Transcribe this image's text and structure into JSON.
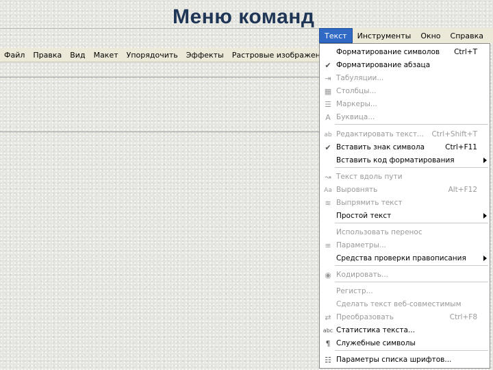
{
  "slide": {
    "title": "Меню команд"
  },
  "main_menubar": [
    "Файл",
    "Правка",
    "Вид",
    "Макет",
    "Упорядочить",
    "Эффекты",
    "Растровые изображения"
  ],
  "top_menubar": [
    {
      "label": "Текст",
      "active": true
    },
    {
      "label": "Инструменты",
      "active": false
    },
    {
      "label": "Окно",
      "active": false
    },
    {
      "label": "Справка",
      "active": false
    }
  ],
  "menu": {
    "items": [
      {
        "label": "Форматирование символов",
        "shortcut": "Ctrl+T",
        "enabled": true,
        "icon": "",
        "submenu": false
      },
      {
        "label": "Форматирование абзаца",
        "shortcut": "",
        "enabled": true,
        "icon": "check-icon",
        "submenu": false
      },
      {
        "label": "Табуляции...",
        "shortcut": "",
        "enabled": false,
        "icon": "tab-icon",
        "submenu": false
      },
      {
        "label": "Столбцы...",
        "shortcut": "",
        "enabled": false,
        "icon": "columns-icon",
        "submenu": false
      },
      {
        "label": "Маркеры...",
        "shortcut": "",
        "enabled": false,
        "icon": "bullets-icon",
        "submenu": false
      },
      {
        "label": "Буквица...",
        "shortcut": "",
        "enabled": false,
        "icon": "dropcap-icon",
        "submenu": false
      },
      {
        "label": "Редактировать текст...",
        "shortcut": "Ctrl+Shift+T",
        "enabled": false,
        "icon": "edit-text-icon",
        "submenu": false
      },
      {
        "label": "Вставить знак символа",
        "shortcut": "Ctrl+F11",
        "enabled": true,
        "icon": "check-icon",
        "submenu": false
      },
      {
        "label": "Вставить код форматирования",
        "shortcut": "",
        "enabled": true,
        "icon": "",
        "submenu": true
      },
      {
        "label": "Текст вдоль пути",
        "shortcut": "",
        "enabled": false,
        "icon": "text-path-icon",
        "submenu": false
      },
      {
        "label": "Выровнять",
        "shortcut": "Alt+F12",
        "enabled": false,
        "icon": "align-icon",
        "submenu": false
      },
      {
        "label": "Выпрямить текст",
        "shortcut": "",
        "enabled": false,
        "icon": "straighten-icon",
        "submenu": false
      },
      {
        "label": "Простой текст",
        "shortcut": "",
        "enabled": true,
        "icon": "",
        "submenu": true
      },
      {
        "label": "Использовать перенос",
        "shortcut": "",
        "enabled": false,
        "icon": "",
        "submenu": false
      },
      {
        "label": "Параметры...",
        "shortcut": "",
        "enabled": false,
        "icon": "params-icon",
        "submenu": false
      },
      {
        "label": "Средства проверки правописания",
        "shortcut": "",
        "enabled": true,
        "icon": "",
        "submenu": true
      },
      {
        "label": "Кодировать...",
        "shortcut": "",
        "enabled": false,
        "icon": "encode-icon",
        "submenu": false
      },
      {
        "label": "Регистр...",
        "shortcut": "",
        "enabled": false,
        "icon": "",
        "submenu": false
      },
      {
        "label": "Сделать текст веб-совместимым",
        "shortcut": "",
        "enabled": false,
        "icon": "",
        "submenu": false
      },
      {
        "label": "Преобразовать",
        "shortcut": "Ctrl+F8",
        "enabled": false,
        "icon": "convert-icon",
        "submenu": false
      },
      {
        "label": "Статистика текста...",
        "shortcut": "",
        "enabled": true,
        "icon": "stats-icon",
        "submenu": false
      },
      {
        "label": "Служебные символы",
        "shortcut": "",
        "enabled": true,
        "icon": "pilcrow-icon",
        "submenu": false
      },
      {
        "label": "Параметры списка шрифтов...",
        "shortcut": "",
        "enabled": true,
        "icon": "font-list-icon",
        "submenu": false
      }
    ]
  }
}
